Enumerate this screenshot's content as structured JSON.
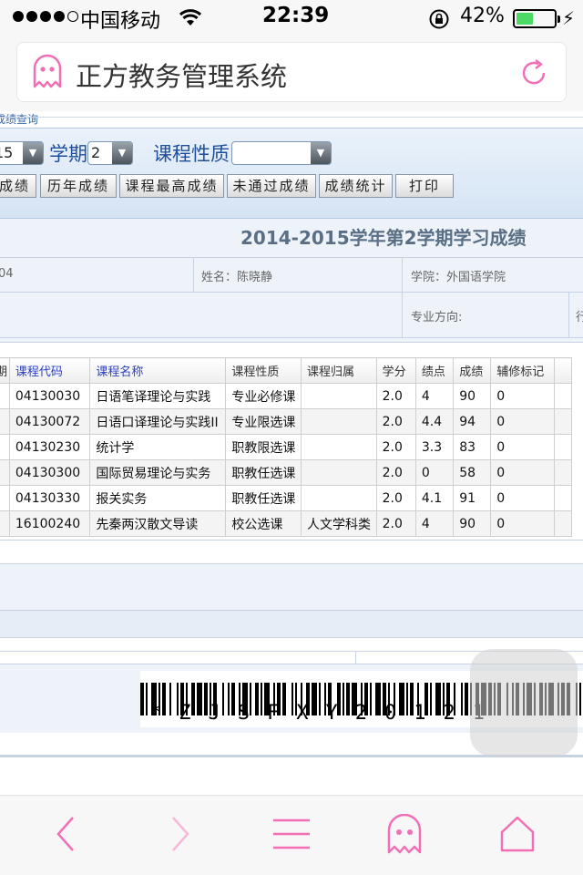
{
  "status": {
    "carrier": "中国移动",
    "time": "22:39",
    "battery": "42%",
    "battery_level": 0.42
  },
  "browser": {
    "title": "正方教务管理系统"
  },
  "breadcrumb": "成绩查询",
  "filters": {
    "year_value": "15",
    "term_label": "学期",
    "term_value": "2",
    "nature_label": "课程性质",
    "nature_value": ""
  },
  "buttons": [
    "成绩",
    "历年成绩",
    "课程最高成绩",
    "未通过成绩",
    "成绩统计",
    "打印"
  ],
  "report": {
    "title": "2014-2015学年第2学期学习成绩",
    "student_id": "04",
    "name": "姓名：陈晓静",
    "college": "学院：外国语学院",
    "major_direction": "专业方向:",
    "partial": "行"
  },
  "table": {
    "headers": [
      "期",
      "课程代码",
      "课程名称",
      "课程性质",
      "课程归属",
      "学分",
      "绩点",
      "成绩",
      "辅修标记",
      ""
    ],
    "rows": [
      [
        "",
        "04130030",
        "日语笔译理论与实践",
        "专业必修课",
        "",
        "2.0",
        "4",
        "90",
        "0",
        ""
      ],
      [
        "",
        "04130072",
        "日语口译理论与实践II",
        "专业限选课",
        "",
        "2.0",
        "4.4",
        "94",
        "0",
        ""
      ],
      [
        "",
        "04130230",
        "统计学",
        "职教限选课",
        "",
        "2.0",
        "3.3",
        "83",
        "0",
        ""
      ],
      [
        "",
        "04130300",
        "国际贸易理论与实务",
        "职教任选课",
        "",
        "2.0",
        "0",
        "58",
        "0",
        ""
      ],
      [
        "",
        "04130330",
        "报关实务",
        "职教任选课",
        "",
        "2.0",
        "4.1",
        "91",
        "0",
        ""
      ],
      [
        "",
        "16100240",
        "先秦两汉散文导读",
        "校公选课",
        "人文学科类",
        "2.0",
        "4",
        "90",
        "0",
        ""
      ]
    ]
  },
  "barcode": {
    "text": "*ZJSFXY20121"
  },
  "toolbar": [
    "back-icon",
    "forward-icon",
    "menu-icon",
    "ghost-icon",
    "home-icon"
  ],
  "colors": {
    "accent": "#f26fb6",
    "header_blue": "#1f4e9a",
    "battery": "#4cd964"
  }
}
